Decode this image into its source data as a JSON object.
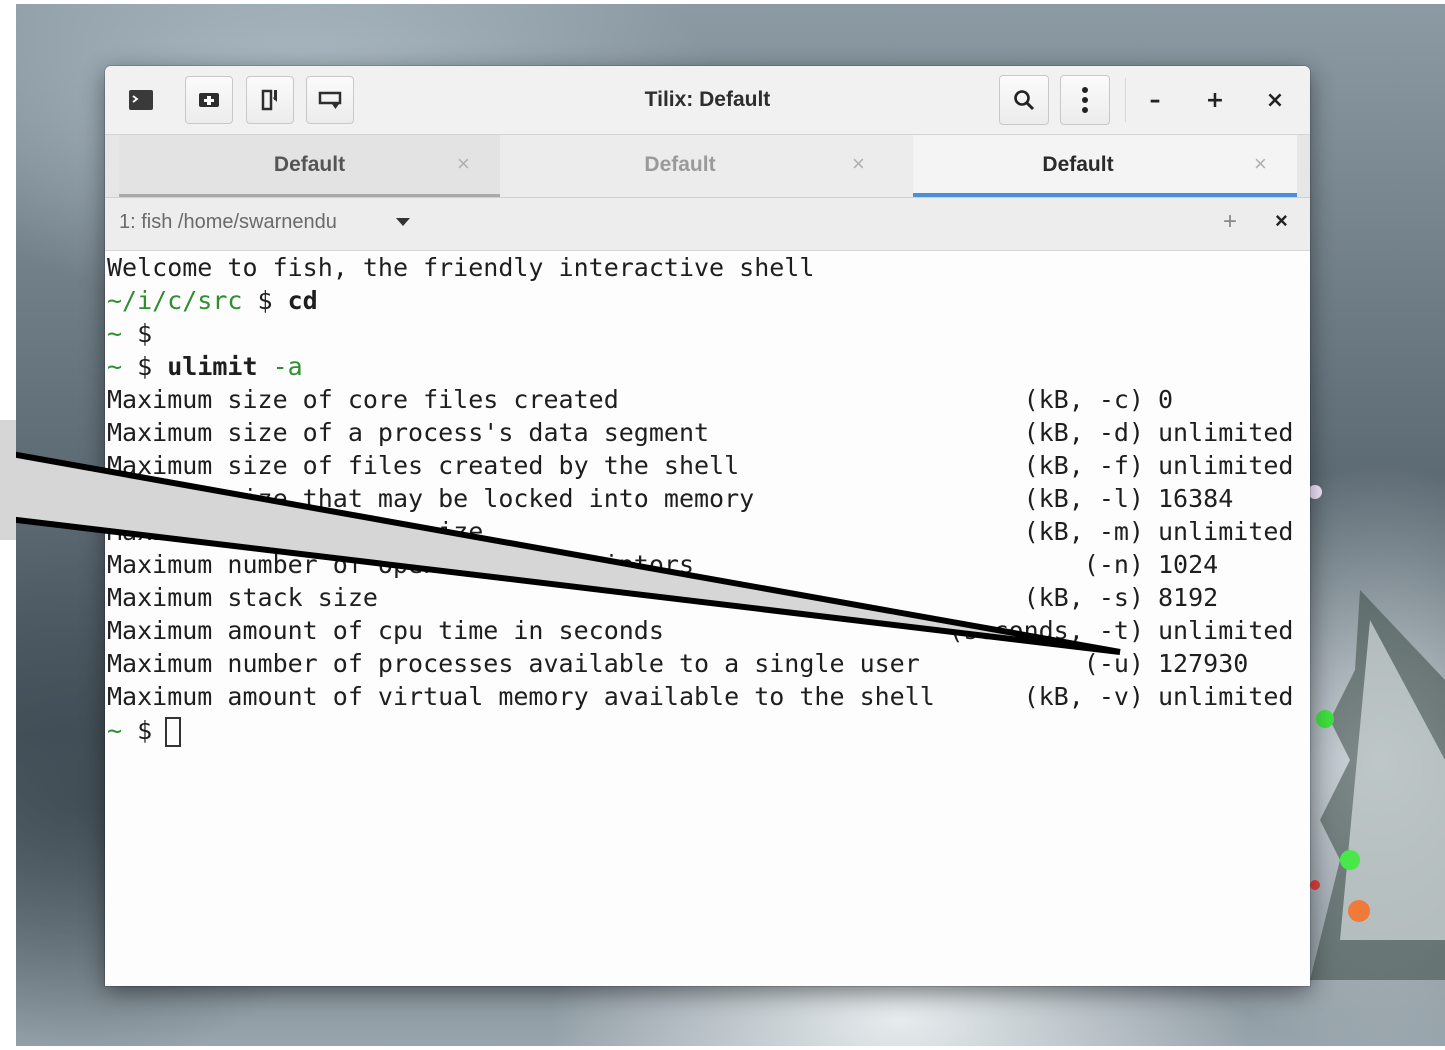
{
  "window": {
    "title": "Tilix: Default"
  },
  "tabs": [
    {
      "label": "Default",
      "active": false
    },
    {
      "label": "Default",
      "active": false
    },
    {
      "label": "Default",
      "active": true
    }
  ],
  "tab_close_glyph": "×",
  "session": {
    "title": "1: fish  /home/swarnendu",
    "add_glyph": "+",
    "close_glyph": "×"
  },
  "wm": {
    "minimize": "–",
    "maximize": "+",
    "close": "×"
  },
  "terminal": {
    "welcome": "Welcome to fish, the friendly interactive shell",
    "prompt1_path": "~/i/c/src",
    "prompt1_sym": " $ ",
    "prompt1_cmd": "cd",
    "prompt2_path": "~",
    "prompt2_sym": " $",
    "prompt3_path": "~",
    "prompt3_sym": " $ ",
    "prompt3_cmd": "ulimit",
    "prompt3_arg": " -a",
    "limits": [
      {
        "desc": "Maximum size of core files created",
        "unit": "(kB, -c)",
        "value": "0"
      },
      {
        "desc": "Maximum size of a process's data segment",
        "unit": "(kB, -d)",
        "value": "unlimited"
      },
      {
        "desc": "Maximum size of files created by the shell",
        "unit": "(kB, -f)",
        "value": "unlimited"
      },
      {
        "desc": "Maximum size that may be locked into memory",
        "unit": "(kB, -l)",
        "value": "16384"
      },
      {
        "desc": "Maximum resident set size",
        "unit": "(kB, -m)",
        "value": "unlimited"
      },
      {
        "desc": "Maximum number of open file descriptors",
        "unit": "(-n)",
        "value": "1024"
      },
      {
        "desc": "Maximum stack size",
        "unit": "(kB, -s)",
        "value": "8192"
      },
      {
        "desc": "Maximum amount of cpu time in seconds",
        "unit": "(seconds, -t)",
        "value": "unlimited"
      },
      {
        "desc": "Maximum number of processes available to a single user",
        "unit": "(-u)",
        "value": "127930"
      },
      {
        "desc": "Maximum amount of virtual memory available to the shell",
        "unit": "(kB, -v)",
        "value": "unlimited"
      }
    ],
    "final_prompt_path": "~",
    "final_prompt_sym": " $ "
  },
  "colors": {
    "prompt_green": "#2f8f2f",
    "tab_active_underline": "#4a90d9",
    "tab_inactive_underline": "#aaaaaa"
  }
}
